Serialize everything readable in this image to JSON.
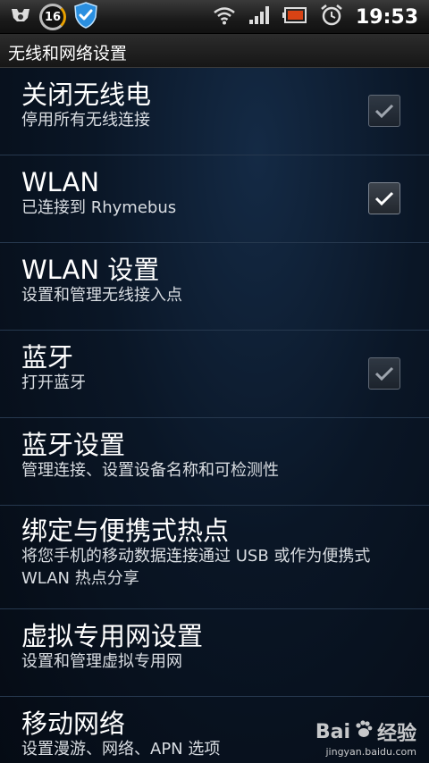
{
  "status_bar": {
    "badge_number": "16",
    "time": "19:53",
    "icons": [
      "controller-icon",
      "badge-16-icon",
      "shield-icon",
      "wifi-icon",
      "signal-icon",
      "battery-icon",
      "alarm-icon"
    ]
  },
  "title_bar": {
    "title": "无线和网络设置"
  },
  "settings": [
    {
      "title": "关闭无线电",
      "subtitle": "停用所有无线连接",
      "has_checkbox": true,
      "checked": true
    },
    {
      "title": "WLAN",
      "subtitle": "已连接到 Rhymebus",
      "has_checkbox": true,
      "checked": true
    },
    {
      "title": "WLAN 设置",
      "subtitle": "设置和管理无线接入点",
      "has_checkbox": false
    },
    {
      "title": "蓝牙",
      "subtitle": "打开蓝牙",
      "has_checkbox": true,
      "checked": true
    },
    {
      "title": "蓝牙设置",
      "subtitle": "管理连接、设置设备名称和可检测性",
      "has_checkbox": false
    },
    {
      "title": "绑定与便携式热点",
      "subtitle": "将您手机的移动数据连接通过 USB 或作为便携式 WLAN 热点分享",
      "has_checkbox": false
    },
    {
      "title": "虚拟专用网设置",
      "subtitle": "设置和管理虚拟专用网",
      "has_checkbox": false
    },
    {
      "title": "移动网络",
      "subtitle": "设置漫游、网络、APN 选项",
      "has_checkbox": false
    }
  ],
  "watermark": {
    "brand": "Bai",
    "brand_suffix": "经验",
    "url": "jingyan.baidu.com"
  },
  "colors": {
    "background": "#0a1626",
    "divider": "#26384e",
    "text_primary": "#ffffff",
    "text_secondary": "#d9dde2",
    "checkbox_border": "#7d8590"
  }
}
